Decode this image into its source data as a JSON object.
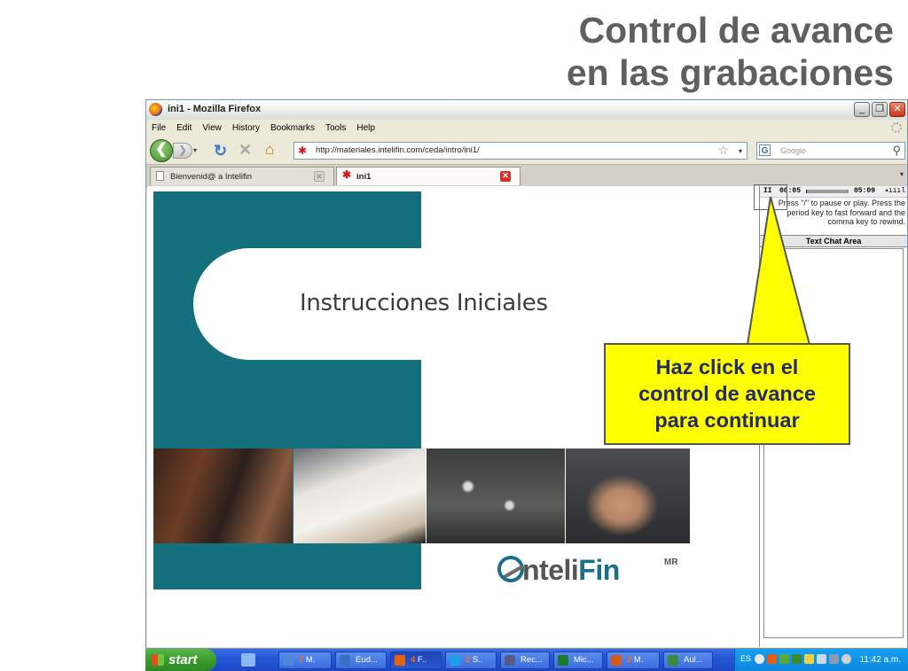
{
  "slide": {
    "title_line1": "Control de avance",
    "title_line2": "en las grabaciones"
  },
  "window": {
    "title": "ini1 - Mozilla Firefox",
    "minimize": "_",
    "maximize": "❐",
    "close": "✕"
  },
  "menu": {
    "items": [
      "File",
      "Edit",
      "View",
      "History",
      "Bookmarks",
      "Tools",
      "Help"
    ]
  },
  "nav": {
    "back": "❮",
    "forward": "❯",
    "dropdown": "▾",
    "reload": "↻",
    "stop": "✕",
    "home": "⌂",
    "url": "http://materiales.intelifin.com/ceda/intro/ini1/",
    "bookmark_star": "☆",
    "search_engine": "G",
    "search_placeholder": "Google",
    "search_button": "⚲"
  },
  "tabs": [
    {
      "label": "Bienvenid@ a Intelifin",
      "active": false,
      "close": "✕"
    },
    {
      "label": "ini1",
      "active": true,
      "close": "✕"
    }
  ],
  "tab_list_button": "▾",
  "content": {
    "heading": "Instrucciones Iniciales",
    "logo_text_1": "nteli",
    "logo_text_2": "Fin",
    "logo_mark": "MR"
  },
  "player": {
    "pause": "II",
    "current_time": "00:05",
    "total_time": "05:09",
    "progress": 0.016,
    "volume": "◂ıııl",
    "instructions": "Press \"/\" to pause or play. Press the period key to fast forward and the comma key to rewind.",
    "chat_header": "Text Chat Area"
  },
  "callout": {
    "line1": "Haz click en el",
    "line2": "control de avance",
    "line3": "para continuar",
    "fill_color": "#ffff00"
  },
  "taskbar": {
    "start": "start",
    "tasks": [
      {
        "count": "7",
        "label": " M.",
        "icon_color": "#4a8ad8"
      },
      {
        "count": "",
        "label": "Eud...",
        "icon_color": "#3a70c0"
      },
      {
        "count": "4",
        "label": " F..",
        "icon_color": "#e8620c"
      },
      {
        "count": "2",
        "label": " S..",
        "icon_color": "#1aa0e8"
      },
      {
        "count": "",
        "label": "Rec...",
        "icon_color": "#5a5a8a"
      },
      {
        "count": "",
        "label": "Mic...",
        "icon_color": "#1a7a2a"
      },
      {
        "count": "2",
        "label": " M.",
        "icon_color": "#d85a1a"
      },
      {
        "count": "",
        "label": "Aul...",
        "icon_color": "#3a8a3a"
      }
    ],
    "language": "ES",
    "clock": "11:42 a.m."
  }
}
